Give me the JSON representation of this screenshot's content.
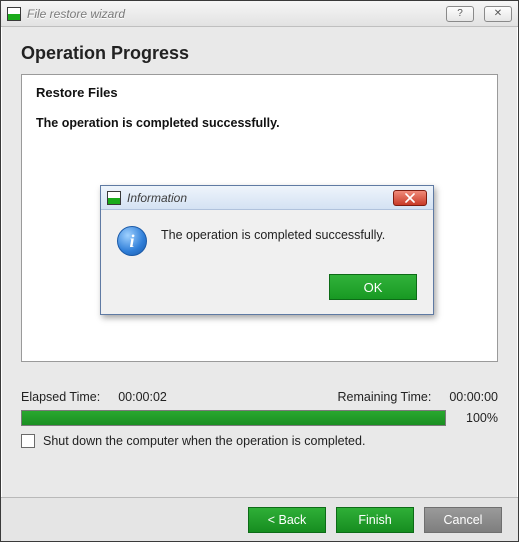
{
  "window": {
    "title": "File restore wizard",
    "help_label": "?",
    "close_label": "✕"
  },
  "page": {
    "title": "Operation Progress",
    "panel_title": "Restore Files",
    "status": "The operation is completed successfully."
  },
  "dialog": {
    "title": "Information",
    "glyph": "i",
    "message": "The operation is completed successfully.",
    "ok_label": "OK"
  },
  "times": {
    "elapsed_label": "Elapsed Time:",
    "elapsed_value": "00:00:02",
    "remaining_label": "Remaining Time:",
    "remaining_value": "00:00:00"
  },
  "progress": {
    "percent_label": "100%"
  },
  "shutdown": {
    "label": "Shut down the computer when the operation is completed.",
    "checked": false
  },
  "footer": {
    "back_label": "< Back",
    "finish_label": "Finish",
    "cancel_label": "Cancel"
  }
}
